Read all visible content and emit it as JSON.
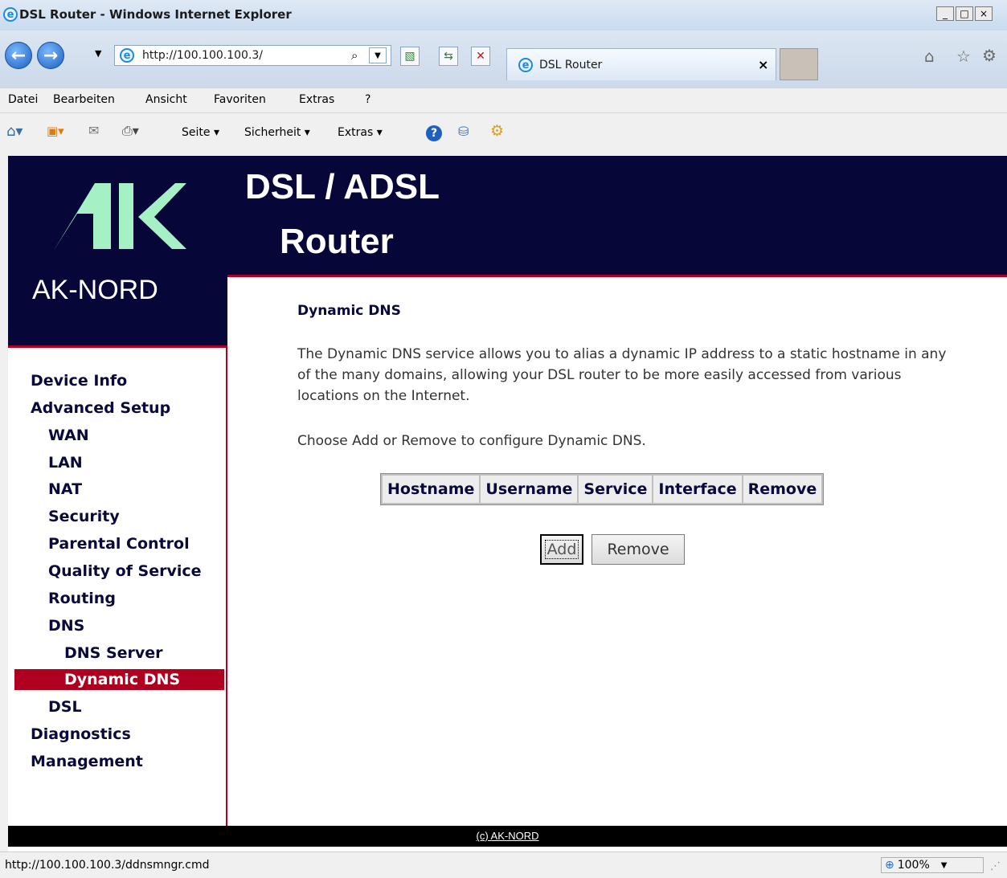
{
  "window": {
    "title": "DSL Router - Windows Internet Explorer",
    "min": "_",
    "max": "□",
    "close": "×"
  },
  "navbar": {
    "url": "http://100.100.100.3/",
    "tab_title": "DSL Router",
    "tab_close": "×"
  },
  "menu": [
    "Datei",
    "Bearbeiten",
    "Ansicht",
    "Favoriten",
    "Extras",
    "?"
  ],
  "commandbar": {
    "page": "Seite ▾",
    "security": "Sicherheit ▾",
    "extras": "Extras ▾"
  },
  "header": {
    "logo_text": "AK-NORD",
    "title_line1": "DSL / ADSL",
    "title_line2": "Router"
  },
  "sidebar": {
    "device_info": "Device Info",
    "advanced_setup": "Advanced Setup",
    "wan": "WAN",
    "lan": "LAN",
    "nat": "NAT",
    "security": "Security",
    "parental": "Parental Control",
    "qos": "Quality of Service",
    "routing": "Routing",
    "dns": "DNS",
    "dns_server": "DNS Server",
    "dynamic_dns": "Dynamic DNS",
    "dsl": "DSL",
    "diagnostics": "Diagnostics",
    "management": "Management"
  },
  "content": {
    "title": "Dynamic DNS",
    "description": "The Dynamic DNS service allows you to alias a dynamic IP address to a static hostname in any of the many domains, allowing your DSL router to be more easily accessed from various locations on the Internet.",
    "instruction": "Choose Add or Remove to configure Dynamic DNS.",
    "table_headers": [
      "Hostname",
      "Username",
      "Service",
      "Interface",
      "Remove"
    ],
    "add_label": "Add",
    "remove_label": "Remove"
  },
  "footer": {
    "copyright": "(c) AK-NORD"
  },
  "statusbar": {
    "status_url": "http://100.100.100.3/ddnsmngr.cmd",
    "zoom": "100%"
  },
  "colors": {
    "header_bg": "#060638",
    "accent_red": "#b00020",
    "logo_green": "#a6f0c6"
  }
}
